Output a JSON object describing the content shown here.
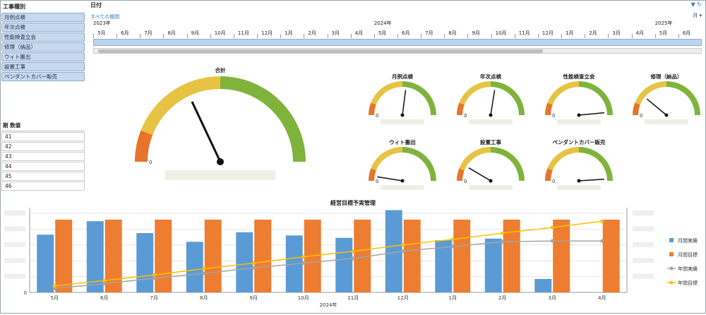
{
  "slicer": {
    "title": "工事種別",
    "items": [
      "月例点検",
      "年次点検",
      "性能検査立会",
      "修理（納品）",
      "ウィト搬出",
      "設置工事",
      "ペンダントカバー販売"
    ]
  },
  "value_list": {
    "header": "期  数値",
    "rows": [
      "41",
      "42",
      "43",
      "44",
      "45",
      "46"
    ]
  },
  "timeline": {
    "title": "日付",
    "link": "すべての期間",
    "unit": "月",
    "icons": [
      "filter-icon",
      "refresh-icon"
    ],
    "years": [
      {
        "label": "2023年",
        "idx": 0
      },
      {
        "label": "2024年",
        "idx": 12
      },
      {
        "label": "2025年",
        "idx": 24
      }
    ],
    "months": [
      "5月",
      "6月",
      "7月",
      "8月",
      "9月",
      "10月",
      "11月",
      "12月",
      "1月",
      "2月",
      "3月",
      "4月",
      "5月",
      "6月",
      "7月",
      "8月",
      "9月",
      "10月",
      "11月",
      "12月",
      "1月",
      "2月",
      "3月",
      "4月",
      "5月",
      "6月"
    ]
  },
  "gauges": {
    "main": {
      "title": "合計",
      "zero": "0"
    },
    "small": [
      {
        "title": "月例点検"
      },
      {
        "title": "年次点検"
      },
      {
        "title": "性能検査立会"
      },
      {
        "title": "修理（納品）"
      },
      {
        "title": "ウィト搬出"
      },
      {
        "title": "設置工事"
      },
      {
        "title": "ペンダントカバー販売"
      }
    ],
    "zero": "0"
  },
  "chart_data": {
    "type": "bar",
    "title": "経営目標予実管理",
    "xlabel": "2024年",
    "categories": [
      "5月",
      "6月",
      "7月",
      "8月",
      "9月",
      "10月",
      "11月",
      "12月",
      "1月",
      "2月",
      "3月",
      "4月"
    ],
    "ylim_left": [
      0,
      100
    ],
    "y_left_zero": "0",
    "series": [
      {
        "name": "月間実績",
        "type": "bar",
        "color": "#5b9bd5",
        "values": [
          73,
          90,
          75,
          64,
          76,
          72,
          69,
          104,
          66,
          68,
          17,
          null
        ]
      },
      {
        "name": "月間目標",
        "type": "bar",
        "color": "#ed7d31",
        "values": [
          92,
          92,
          92,
          92,
          92,
          92,
          92,
          92,
          92,
          92,
          92,
          92
        ]
      },
      {
        "name": "年間実績",
        "type": "line",
        "color": "#a5a5a5",
        "values": [
          5,
          11,
          18,
          24,
          31,
          37,
          43,
          52,
          58,
          64,
          65,
          65
        ]
      },
      {
        "name": "年間目標",
        "type": "line",
        "color": "#ffc000",
        "values": [
          8,
          15,
          22,
          30,
          37,
          45,
          52,
          60,
          67,
          75,
          82,
          90
        ]
      }
    ],
    "ylim_lines": [
      0,
      100
    ],
    "legend": "right"
  }
}
